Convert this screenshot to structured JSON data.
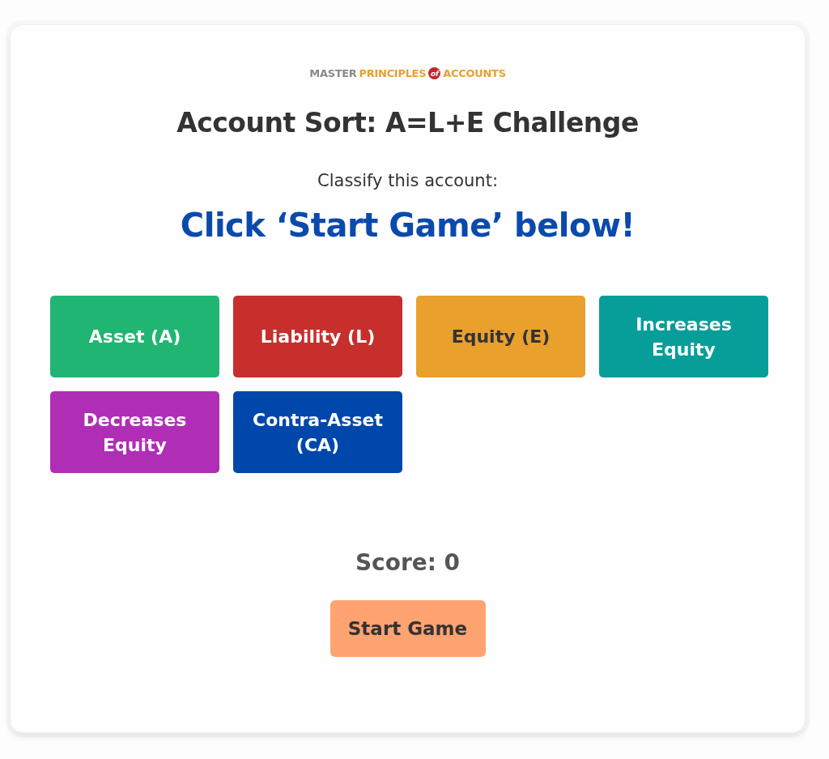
{
  "logo": {
    "word_1": "MASTER",
    "word_2": "PRINCIPLES",
    "word_3": "of",
    "word_4": "ACCOUNTS"
  },
  "title": "Account Sort: A=L+E Challenge",
  "instruction": "Classify this account:",
  "prompt": "Click ‘Start Game’ below!",
  "categories": [
    {
      "label": "Asset (A)",
      "color": "#21b573"
    },
    {
      "label": "Liability (L)",
      "color": "#c62f2c"
    },
    {
      "label": "Equity (E)",
      "color": "#e9a02d"
    },
    {
      "label": "Increases Equity",
      "color": "#079e9a"
    },
    {
      "label": "Decreases Equity",
      "color": "#b02eb6"
    },
    {
      "label": "Contra-Asset (CA)",
      "color": "#0047ab"
    }
  ],
  "score": "Score: 0",
  "start_button": "Start Game"
}
